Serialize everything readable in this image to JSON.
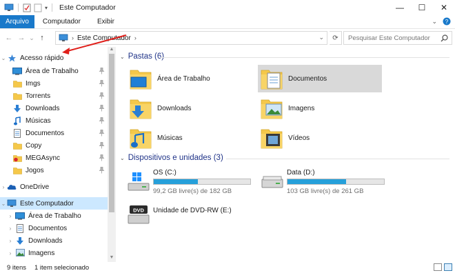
{
  "window": {
    "title": "Este Computador",
    "controls": {
      "minimize": "—",
      "maximize": "☐",
      "close": "✕"
    }
  },
  "ribbon": {
    "tabs": [
      "Arquivo",
      "Computador",
      "Exibir"
    ]
  },
  "address": {
    "back": "←",
    "forward": "→",
    "recent": "⌄",
    "up": "↑",
    "location": "Este Computador",
    "refresh": "⟳"
  },
  "search": {
    "placeholder": "Pesquisar Este Computador"
  },
  "nav": {
    "quick_access": "Acesso rápido",
    "quick_items": [
      {
        "label": "Área de Trabalho",
        "icon": "desktop-icon"
      },
      {
        "label": "Imgs",
        "icon": "folder-icon"
      },
      {
        "label": "Torrents",
        "icon": "folder-icon"
      },
      {
        "label": "Downloads",
        "icon": "downloads-icon"
      },
      {
        "label": "Músicas",
        "icon": "music-icon"
      },
      {
        "label": "Documentos",
        "icon": "documents-icon"
      },
      {
        "label": "Copy",
        "icon": "folder-icon"
      },
      {
        "label": "MEGAsync",
        "icon": "megasync-icon"
      },
      {
        "label": "Jogos",
        "icon": "folder-icon"
      }
    ],
    "onedrive": "OneDrive",
    "this_pc": "Este Computador",
    "pc_items": [
      {
        "label": "Área de Trabalho",
        "icon": "desktop-icon"
      },
      {
        "label": "Documentos",
        "icon": "documents-icon"
      },
      {
        "label": "Downloads",
        "icon": "downloads-icon"
      },
      {
        "label": "Imagens",
        "icon": "pictures-icon"
      }
    ]
  },
  "folders": {
    "header": "Pastas (6)",
    "items": [
      {
        "label": "Área de Trabalho",
        "icon": "desktop-folder-icon",
        "selected": false
      },
      {
        "label": "Documentos",
        "icon": "documents-folder-icon",
        "selected": true
      },
      {
        "label": "Downloads",
        "icon": "downloads-folder-icon",
        "selected": false
      },
      {
        "label": "Imagens",
        "icon": "pictures-folder-icon",
        "selected": false
      },
      {
        "label": "Músicas",
        "icon": "music-folder-icon",
        "selected": false
      },
      {
        "label": "Vídeos",
        "icon": "videos-folder-icon",
        "selected": false
      }
    ]
  },
  "devices": {
    "header": "Dispositivos e unidades (3)",
    "drives": [
      {
        "name": "OS (C:)",
        "free": "99,2 GB livre(s) de 182 GB",
        "used_fraction": 0.455,
        "icon": "windows-drive-icon"
      },
      {
        "name": "Data (D:)",
        "free": "103 GB livre(s) de 261 GB",
        "used_fraction": 0.605,
        "icon": "hard-drive-icon"
      }
    ],
    "dvd": {
      "name": "Unidade de DVD-RW (E:)",
      "badge": "DVD",
      "icon": "dvd-drive-icon"
    }
  },
  "status": {
    "count": "9 itens",
    "selected": "1 item selecionado"
  },
  "colors": {
    "accent": "#1979ca",
    "selection": "#cce8ff",
    "drive_bar": "#26a0da",
    "group_header": "#1e3287",
    "annotation_arrow": "#e0201b"
  }
}
